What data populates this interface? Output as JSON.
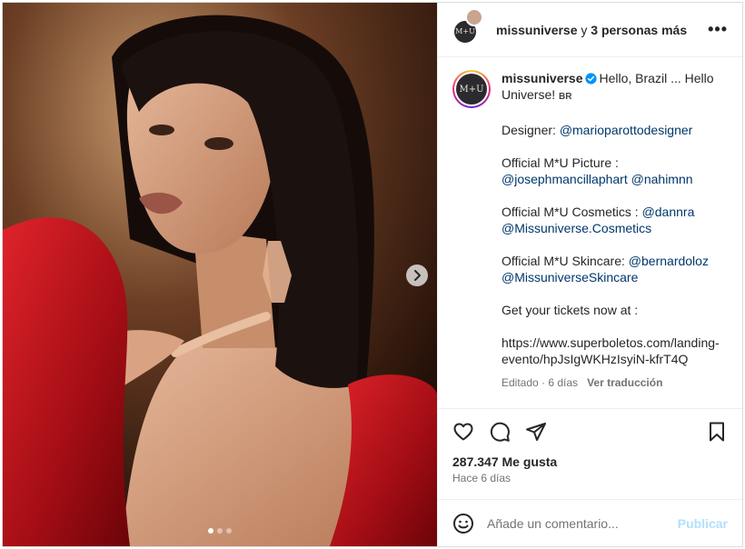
{
  "header": {
    "username": "missuniverse",
    "joiner": " y ",
    "collaborators": "3 personas más",
    "avatar_text": "M+U",
    "more_icon": "more-horizontal-icon",
    "more_glyph": "•••"
  },
  "caption": {
    "username": "missuniverse",
    "verified_icon": "verified-badge-icon",
    "intro": "Hello, Brazil ... Hello Universe!",
    "flag": "BR",
    "designer_label": "Designer:",
    "designer_handle": "@marioparottodesigner",
    "picture_label": "Official M*U Picture :",
    "picture_handles": [
      "@josephmancillaphart",
      "@nahimnn"
    ],
    "cosmetics_label": "Official M*U Cosmetics :",
    "cosmetics_handles": [
      "@dannra",
      "@Missuniverse.Cosmetics"
    ],
    "skincare_label": "Official M*U Skincare:",
    "skincare_handles": [
      "@bernardoloz",
      "@MissuniverseSkincare"
    ],
    "tickets_label": "Get your tickets now at :",
    "tickets_url": "https://www.superboletos.com/landing-evento/hpJsIgWKHzIsyiN-kfrT4Q",
    "edited": "Editado · 6 días",
    "translate": "Ver traducción"
  },
  "actions": {
    "like_icon": "heart-icon",
    "comment_icon": "comment-icon",
    "share_icon": "share-icon",
    "save_icon": "bookmark-icon"
  },
  "likes": "287.347 Me gusta",
  "posted": "Hace 6 días",
  "comment": {
    "emoji_icon": "emoji-icon",
    "placeholder": "Añade un comentario...",
    "publish": "Publicar"
  },
  "carousel": {
    "next_icon": "chevron-right-icon",
    "slides": 3,
    "active_index": 0
  },
  "colors": {
    "link": "#00376b",
    "publish_disabled": "#b2dffc",
    "verified": "#0095f6",
    "dress_red": "#c0141c"
  }
}
